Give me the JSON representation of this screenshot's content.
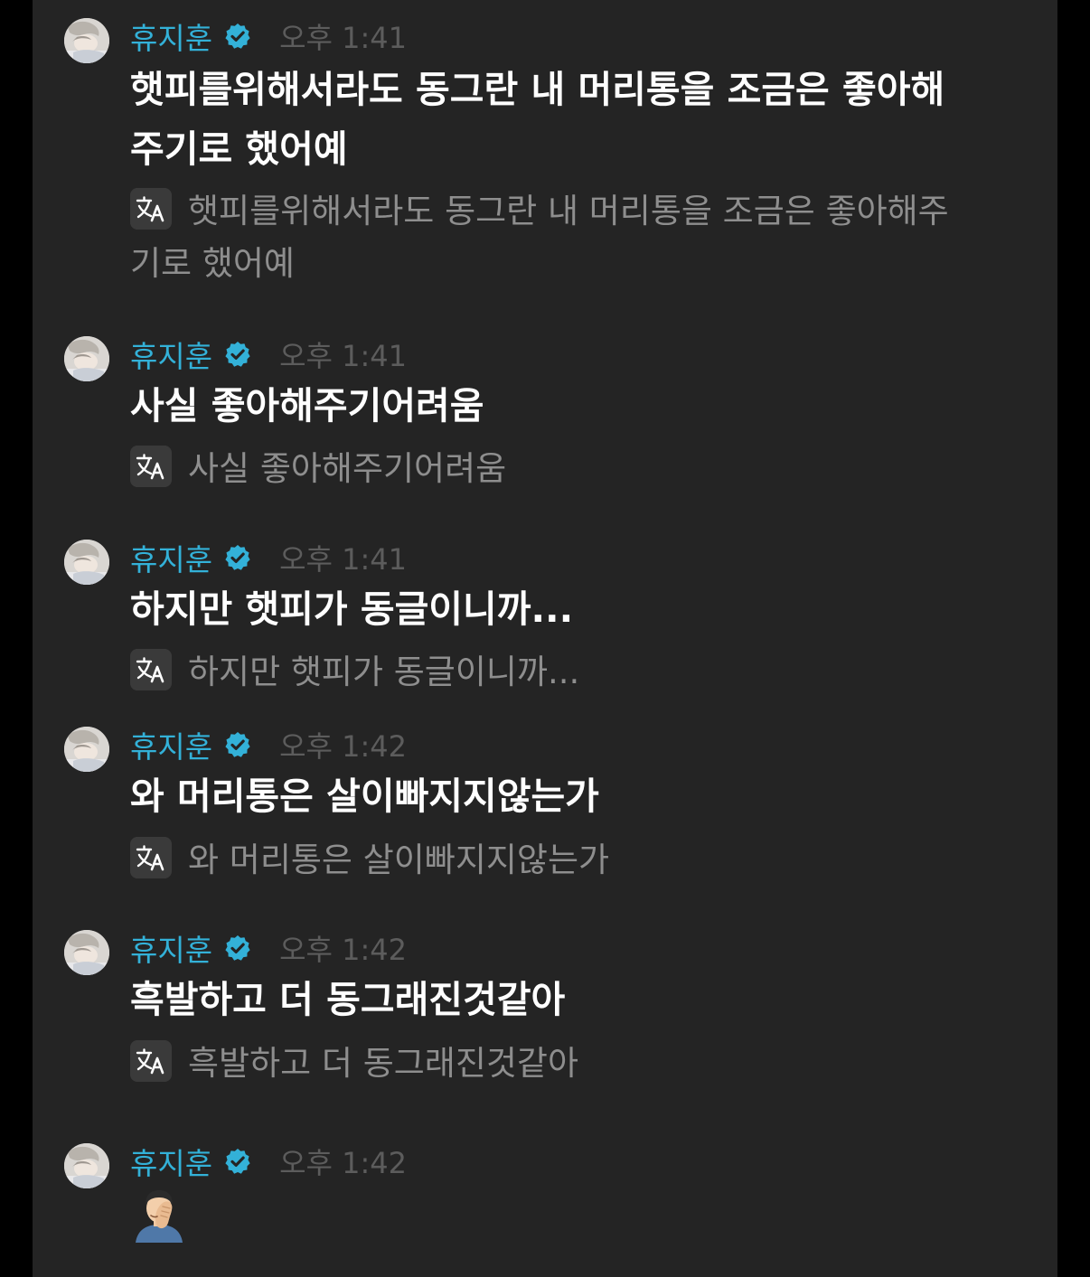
{
  "colors": {
    "background": "#242424",
    "sender_name": "#33b1d8",
    "timestamp": "#5c5c5c",
    "message_text": "#ffffff",
    "translation_text": "#8e8e8e"
  },
  "messages": [
    {
      "sender": "휴지훈",
      "verified_icon": "verified-badge-icon",
      "time": "오후 1:41",
      "text_line1": "햇피를위해서라도 동그란 내 머리통을 조금은 좋아해",
      "text_line2": "주기로 했어예",
      "translation_icon": "translate-icon",
      "translation_line1": "햇피를위해서라도 동그란 내 머리통을 조금은 좋아해주",
      "translation_line2": "기로 했어예"
    },
    {
      "sender": "휴지훈",
      "verified_icon": "verified-badge-icon",
      "time": "오후 1:41",
      "text": "사실 좋아해주기어려움",
      "translation_icon": "translate-icon",
      "translation": "사실 좋아해주기어려움"
    },
    {
      "sender": "휴지훈",
      "verified_icon": "verified-badge-icon",
      "time": "오후 1:41",
      "text": "하지만 햇피가 동글이니까...",
      "translation_icon": "translate-icon",
      "translation": "하지만 햇피가 동글이니까..."
    },
    {
      "sender": "휴지훈",
      "verified_icon": "verified-badge-icon",
      "time": "오후 1:42",
      "text": "와 머리통은 살이빠지지않는가",
      "translation_icon": "translate-icon",
      "translation": "와 머리통은 살이빠지지않는가"
    },
    {
      "sender": "휴지훈",
      "verified_icon": "verified-badge-icon",
      "time": "오후 1:42",
      "text": "흑발하고 더 동그래진것같아",
      "translation_icon": "translate-icon",
      "translation": "흑발하고 더 동그래진것같아"
    },
    {
      "sender": "휴지훈",
      "verified_icon": "verified-badge-icon",
      "time": "오후 1:42",
      "emoji": "face-palm-man-emoji"
    }
  ]
}
